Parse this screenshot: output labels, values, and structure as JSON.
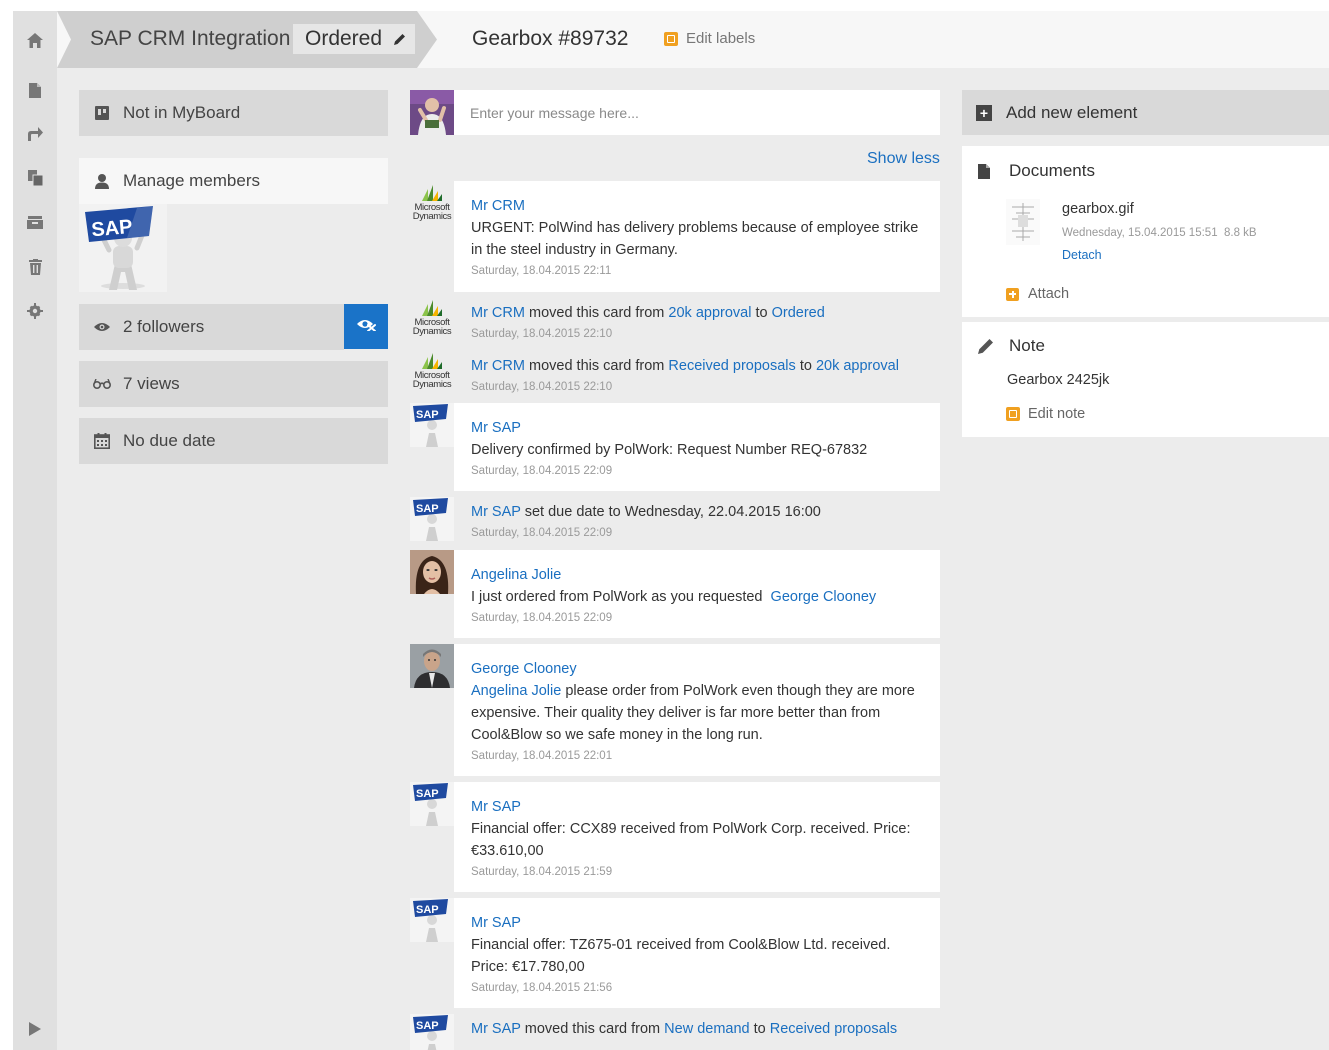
{
  "header": {
    "board_title": "SAP CRM Integration",
    "status": "Ordered",
    "card_title": "Gearbox #89732",
    "edit_labels": "Edit labels"
  },
  "rail": {
    "icons": [
      "home-icon",
      "document-icon",
      "share-icon",
      "copy-icon",
      "archive-icon",
      "trash-icon",
      "settings-icon",
      "expand-icon"
    ]
  },
  "left": {
    "myboard": "Not in MyBoard",
    "manage_members": "Manage members",
    "followers": "2 followers",
    "views": "7 views",
    "due_date": "No due date"
  },
  "composer": {
    "placeholder": "Enter your message here..."
  },
  "feed": {
    "show_less": "Show less",
    "items": [
      {
        "author": "Mr CRM",
        "text": "URGENT: PolWind has delivery problems because of employee strike in the steel industry in Germany.",
        "time": "Saturday, 18.04.2015 22:11"
      },
      {
        "author": "Mr CRM",
        "verb": "moved this card from",
        "from": "20k approval",
        "to_word": "to",
        "to": "Ordered",
        "time": "Saturday, 18.04.2015 22:10"
      },
      {
        "author": "Mr CRM",
        "verb": "moved this card from",
        "from": "Received proposals",
        "to_word": "to",
        "to": "20k approval",
        "time": "Saturday, 18.04.2015 22:10"
      },
      {
        "author": "Mr SAP",
        "text": "Delivery confirmed by PolWork: Request Number REQ-67832",
        "time": "Saturday, 18.04.2015 22:09"
      },
      {
        "author": "Mr SAP",
        "text": "set due date to Wednesday, 22.04.2015 16:00",
        "time": "Saturday, 18.04.2015 22:09"
      },
      {
        "author": "Angelina Jolie",
        "text": "I just ordered from PolWork as you requested",
        "mention": "George Clooney",
        "time": "Saturday, 18.04.2015 22:09"
      },
      {
        "author": "George Clooney",
        "mention": "Angelina Jolie",
        "text": "please order from PolWork even though they are more expensive. Their quality they deliver is far more better than from Cool&Blow so we safe money in the long run.",
        "time": "Saturday, 18.04.2015 22:01"
      },
      {
        "author": "Mr SAP",
        "text": "Financial offer: CCX89 received from PolWork Corp. received. Price: €33.610,00",
        "time": "Saturday, 18.04.2015 21:59"
      },
      {
        "author": "Mr SAP",
        "text": "Financial offer: TZ675-01 received from Cool&Blow Ltd. received. Price: €17.780,00",
        "time": "Saturday, 18.04.2015 21:56"
      },
      {
        "author": "Mr SAP",
        "verb": "moved this card from",
        "from": "New demand",
        "to_word": "to",
        "to": "Received proposals"
      }
    ]
  },
  "logos": {
    "ms_line1": "Microsoft",
    "ms_line2": "Dynamics",
    "sap": "SAP"
  },
  "right": {
    "add_new": "Add new element",
    "documents_title": "Documents",
    "doc_name": "gearbox.gif",
    "doc_date": "Wednesday, 15.04.2015 15:51",
    "doc_size": "8.8 kB",
    "detach": "Detach",
    "attach": "Attach",
    "note_title": "Note",
    "note_text": "Gearbox 2425jk",
    "edit_note": "Edit note"
  },
  "colors": {
    "link": "#1a6fc0",
    "accent_orange": "#f0a020",
    "toggle_blue": "#1a73c8"
  }
}
